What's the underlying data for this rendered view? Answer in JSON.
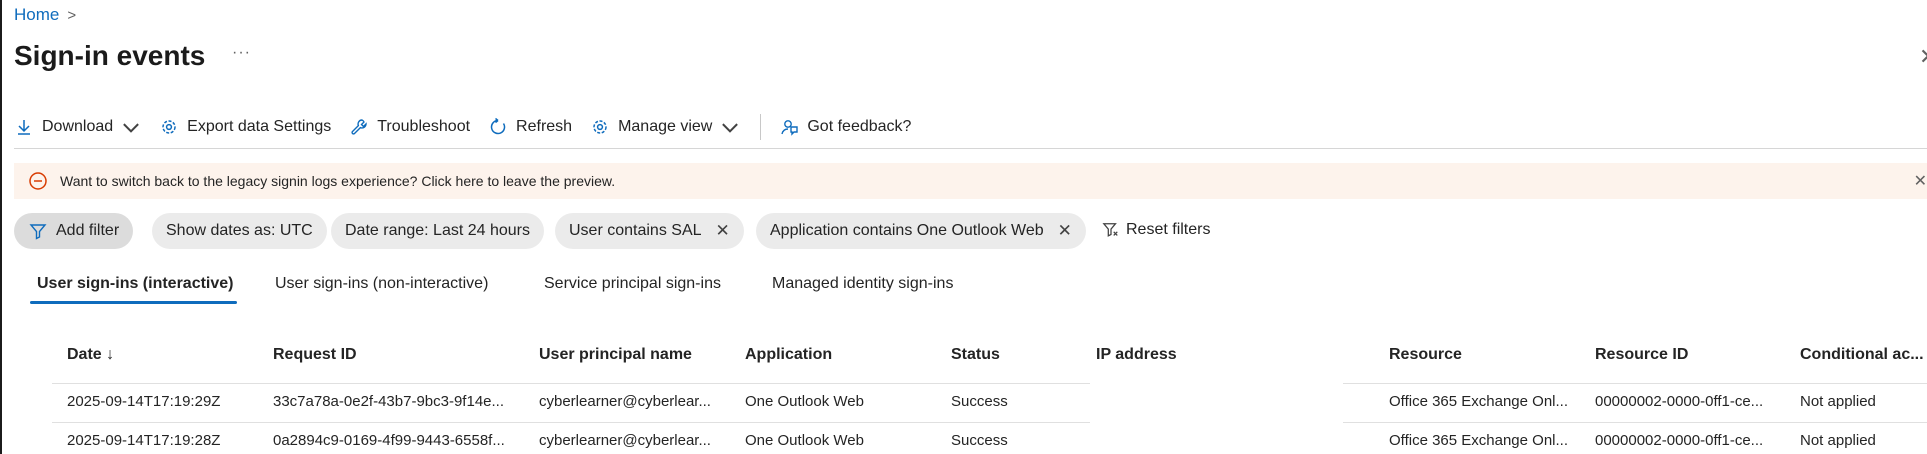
{
  "breadcrumb": {
    "home": "Home",
    "separator": ">"
  },
  "page": {
    "title": "Sign-in events",
    "more": "···",
    "close": "✕"
  },
  "toolbar": {
    "download": "Download",
    "export": "Export data Settings",
    "troubleshoot": "Troubleshoot",
    "refresh": "Refresh",
    "manage_view": "Manage view",
    "feedback": "Got feedback?"
  },
  "banner": {
    "text": "Want to switch back to the legacy signin logs experience? Click here to leave the preview.",
    "close": "✕"
  },
  "filters": {
    "add": "Add filter",
    "dates": "Show dates as: UTC",
    "range": "Date range: Last 24 hours",
    "user": "User contains SAL",
    "app": "Application contains One Outlook Web",
    "remove": "✕",
    "reset": "Reset filters"
  },
  "tabs": [
    {
      "label": "User sign-ins (interactive)",
      "active": true
    },
    {
      "label": "User sign-ins (non-interactive)",
      "active": false
    },
    {
      "label": "Service principal sign-ins",
      "active": false
    },
    {
      "label": "Managed identity sign-ins",
      "active": false
    }
  ],
  "table": {
    "columns": [
      "Date ↓",
      "Request ID",
      "User principal name",
      "Application",
      "Status",
      "IP address",
      "Resource",
      "Resource ID",
      "Conditional ac..."
    ],
    "rows": [
      {
        "date": "2025-09-14T17:19:29Z",
        "request_id": "33c7a78a-0e2f-43b7-9bc3-9f14e...",
        "upn": "cyberlearner@cyberlear...",
        "application": "One Outlook Web",
        "status": "Success",
        "ip": "",
        "resource": "Office 365 Exchange Onl...",
        "resource_id": "00000002-0000-0ff1-ce...",
        "conditional": "Not applied"
      },
      {
        "date": "2025-09-14T17:19:28Z",
        "request_id": "0a2894c9-0169-4f99-9443-6558f...",
        "upn": "cyberlearner@cyberlear...",
        "application": "One Outlook Web",
        "status": "Success",
        "ip": "",
        "resource": "Office 365 Exchange Onl...",
        "resource_id": "00000002-0000-0ff1-ce...",
        "conditional": "Not applied"
      }
    ]
  },
  "colors": {
    "accent": "#0f6cbd",
    "banner_bg": "#fdf3ec",
    "warning": "#d83b01",
    "pill_bg": "#ebebeb"
  }
}
